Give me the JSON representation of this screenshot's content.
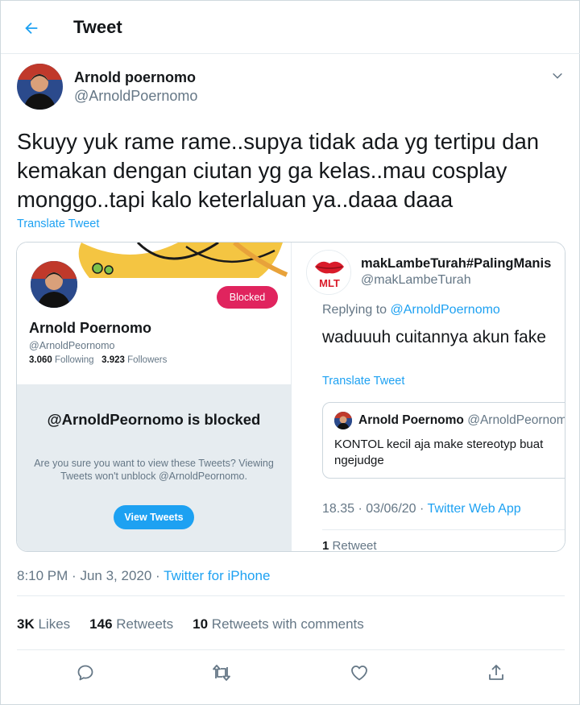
{
  "header": {
    "title": "Tweet",
    "back_icon": "arrow-left-icon"
  },
  "author": {
    "name": "Arnold poernomo",
    "handle": "@ArnoldPoernomo"
  },
  "tweet": {
    "text": "Skuyy yuk rame rame..supya tidak ada yg tertipu dan\nkemakan dengan ciutan yg ga kelas..mau cosplay\nmonggo..tapi kalo keterlaluan ya..daaa daaa",
    "translate_label": "Translate Tweet",
    "time": "8:10 PM",
    "separator": "·",
    "date": "Jun 3, 2020",
    "source": "Twitter for iPhone"
  },
  "media": {
    "profile": {
      "blocked_label": "Blocked",
      "name": "Arnold Poernomo",
      "handle": "@ArnoldPeornomo",
      "following_count": "3.060",
      "following_label": "Following",
      "followers_count": "3.923",
      "followers_label": "Followers",
      "blocked_title": "@ArnoldPeornomo is blocked",
      "blocked_desc": "Are you sure you want to view these Tweets? Viewing Tweets won't unblock @ArnoldPeornomo.",
      "view_button": "View Tweets"
    },
    "reply": {
      "logo_text": "MLT",
      "name": "makLambeTurah#PalingManis",
      "handle": "@makLambeTurah",
      "replying_prefix": "Replying to",
      "replying_to": "@ArnoldPoernomo",
      "text": "waduuuh cuitannya akun fake",
      "translate_label": "Translate Tweet",
      "quote": {
        "name": "Arnold Poernomo",
        "handle": "@ArnoldPeornom",
        "text": "KONTOL kecil aja make stereotyp buat ngejudge"
      },
      "time": "18.35",
      "date": "03/06/20",
      "source": "Twitter Web App",
      "retweet_count": "1",
      "retweet_label": "Retweet"
    }
  },
  "stats": {
    "likes_count": "3K",
    "likes_label": "Likes",
    "retweets_count": "146",
    "retweets_label": "Retweets",
    "comments_count": "10",
    "comments_label": "Retweets with comments"
  },
  "actions": [
    "reply-icon",
    "retweet-icon",
    "like-icon",
    "share-icon"
  ],
  "colors": {
    "accent": "#1da1f2",
    "blocked": "#e0245e",
    "text": "#14171a",
    "muted": "#657786"
  }
}
